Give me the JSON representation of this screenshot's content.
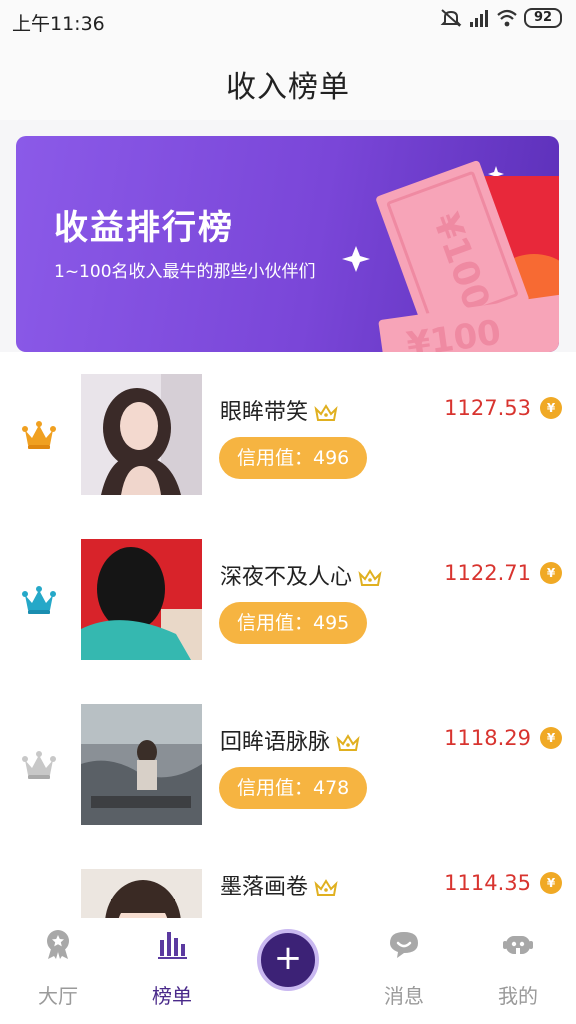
{
  "status": {
    "time": "上午11:36",
    "battery": "92"
  },
  "header": {
    "title": "收入榜单"
  },
  "banner": {
    "title": "收益排行榜",
    "subtitle": "1~100名收入最牛的那些小伙伴们",
    "note_text": "¥100"
  },
  "rows": [
    {
      "name": "眼眸带笑",
      "credit": "信用值：496",
      "amount": "1127.53",
      "coin": "¥"
    },
    {
      "name": "深夜不及人心",
      "credit": "信用值：495",
      "amount": "1122.71",
      "coin": "¥"
    },
    {
      "name": "回眸语脉脉",
      "credit": "信用值：478",
      "amount": "1118.29",
      "coin": "¥"
    },
    {
      "name": "墨落画卷",
      "amount": "1114.35",
      "coin": "¥"
    }
  ],
  "tabs": [
    {
      "label": "大厅"
    },
    {
      "label": "榜单"
    },
    {
      "label": "+"
    },
    {
      "label": "消息"
    },
    {
      "label": "我的"
    }
  ],
  "colors": {
    "accent": "#4a2a8a",
    "badge": "#f6b441",
    "amount": "#d8342f",
    "crown_gold": "#f0a020",
    "crown_teal": "#25a8c8",
    "crown_silver": "#c8c8c8"
  }
}
